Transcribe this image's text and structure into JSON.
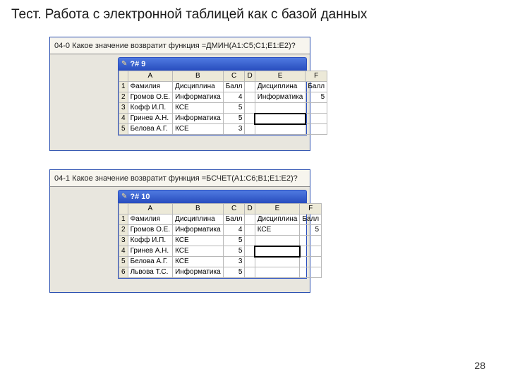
{
  "page": {
    "title": "Тест. Работа с электронной таблицей как с базой данных",
    "number": "28"
  },
  "blocks": [
    {
      "question": "04-0 Какое значение возвратит функция =ДМИН(A1:C5;C1;E1:E2)?",
      "window_title": "?# 9",
      "columns": [
        "A",
        "B",
        "C",
        "D",
        "E",
        "F"
      ],
      "select_row": 4,
      "select_col_letter": "E",
      "rows": [
        {
          "n": "1",
          "A": "Фамилия",
          "B": "Дисциплина",
          "C": "Балл",
          "D": "",
          "E": "Дисциплина",
          "F": "Балл"
        },
        {
          "n": "2",
          "A": "Громов О.Е.",
          "B": "Информатика",
          "C": "4",
          "D": "",
          "E": "Информатика",
          "F": "5"
        },
        {
          "n": "3",
          "A": "Кофф И.П.",
          "B": "КСЕ",
          "C": "5",
          "D": "",
          "E": "",
          "F": ""
        },
        {
          "n": "4",
          "A": "Гринев А.Н.",
          "B": "Информатика",
          "C": "5",
          "D": "",
          "E": "",
          "F": ""
        },
        {
          "n": "5",
          "A": "Белова А.Г.",
          "B": "КСЕ",
          "C": "3",
          "D": "",
          "E": "",
          "F": ""
        }
      ]
    },
    {
      "question": "04-1 Какое значение возвратит функция =БСЧЕТ(A1:C6;B1;E1:E2)?",
      "window_title": "?# 10",
      "columns": [
        "A",
        "B",
        "C",
        "D",
        "E",
        "F"
      ],
      "select_row": 4,
      "select_col_letter": "E",
      "rows": [
        {
          "n": "1",
          "A": "Фамилия",
          "B": "Дисциплина",
          "C": "Балл",
          "D": "",
          "E": "Дисциплина",
          "F": "Балл"
        },
        {
          "n": "2",
          "A": "Громов О.Е.",
          "B": "Информатика",
          "C": "4",
          "D": "",
          "E": "КСЕ",
          "F": "5"
        },
        {
          "n": "3",
          "A": "Кофф И.П.",
          "B": "КСЕ",
          "C": "5",
          "D": "",
          "E": "",
          "F": ""
        },
        {
          "n": "4",
          "A": "Гринев А.Н.",
          "B": "КСЕ",
          "C": "5",
          "D": "",
          "E": "",
          "F": ""
        },
        {
          "n": "5",
          "A": "Белова А.Г.",
          "B": "КСЕ",
          "C": "3",
          "D": "",
          "E": "",
          "F": ""
        },
        {
          "n": "6",
          "A": "Львова Т.С.",
          "B": "Информатика",
          "C": "5",
          "D": "",
          "E": "",
          "F": ""
        }
      ]
    }
  ]
}
